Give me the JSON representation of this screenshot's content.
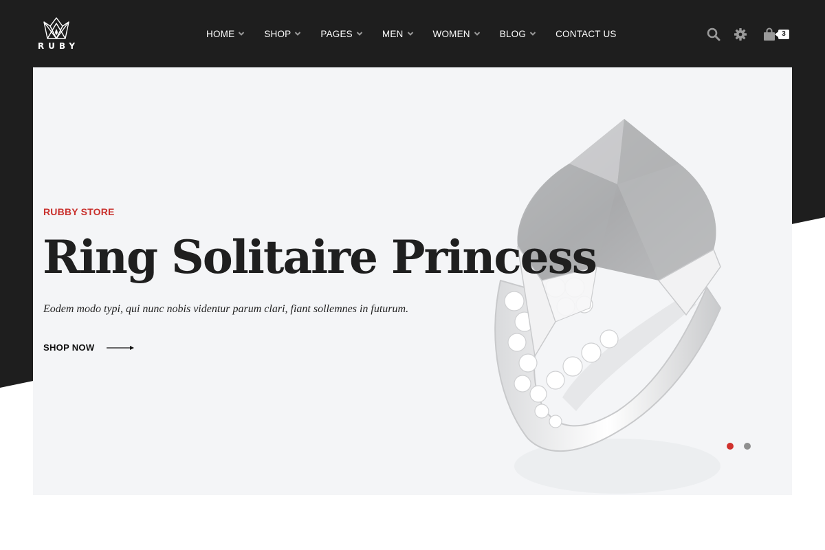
{
  "brand": {
    "name": "RUBY"
  },
  "nav": {
    "items": [
      {
        "label": "HOME",
        "has_dropdown": true
      },
      {
        "label": "SHOP",
        "has_dropdown": true
      },
      {
        "label": "PAGES",
        "has_dropdown": true
      },
      {
        "label": "MEN",
        "has_dropdown": true
      },
      {
        "label": "WOMEN",
        "has_dropdown": true
      },
      {
        "label": "BLOG",
        "has_dropdown": true
      },
      {
        "label": "CONTACT US",
        "has_dropdown": false
      }
    ]
  },
  "header_icons": {
    "search": "search-icon",
    "settings": "gear-icon",
    "cart": "shopping-bag-icon",
    "cart_count": "3"
  },
  "hero": {
    "kicker": "RUBBY STORE",
    "title": "Ring Solitaire Princess",
    "description": "Eodem modo typi, qui nunc nobis videntur parum clari, fiant sollemnes in futurum.",
    "cta_label": "SHOP NOW",
    "image": "ring-with-gemstone",
    "slides_total": 2,
    "active_slide": 1
  },
  "colors": {
    "header_bg": "#1e1e1e",
    "hero_bg": "#f4f5f7",
    "accent": "#c9302c",
    "text_dark": "#1f1f1f",
    "inactive_dot": "#8f8f8f"
  }
}
